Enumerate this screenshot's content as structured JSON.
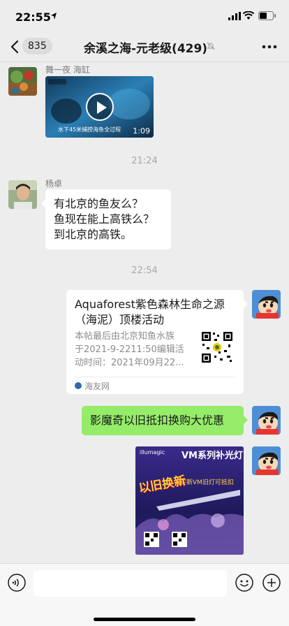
{
  "status_bar": {
    "time": "22:55"
  },
  "nav": {
    "unread_count": "835",
    "title": "余溪之海-元老级(429)"
  },
  "messages": [
    {
      "type": "video",
      "sender": "舞一夜 海缸",
      "duration": "1:09",
      "caption": "水下45米捕捞海鱼全过程"
    },
    {
      "type": "timestamp",
      "text": "21:24"
    },
    {
      "type": "text",
      "sender": "杨卓",
      "lines": [
        "有北京的鱼友么？",
        "鱼现在能上高铁么？",
        "到北京的高铁。"
      ]
    },
    {
      "type": "timestamp",
      "text": "22:54"
    },
    {
      "type": "link_card",
      "title": "Aquaforest紫色森林生命之源（海泥）顶楼活动",
      "desc_lines": [
        "本帖最后由北京知鱼水族",
        "于2021-9-2211:50编辑活",
        "动时间：2021年09月22..."
      ],
      "source": "海友网"
    },
    {
      "type": "text_self",
      "text": "影魔奇以旧抵扣换购大优惠"
    },
    {
      "type": "image_self",
      "poster": {
        "brand": "illumagic",
        "headline": "VM系列补光灯",
        "promo": "以旧换新",
        "subline": "买新VM旧灯可抵扣"
      }
    }
  ],
  "colors": {
    "self_bubble": "#95ec69",
    "background": "#ededed"
  }
}
